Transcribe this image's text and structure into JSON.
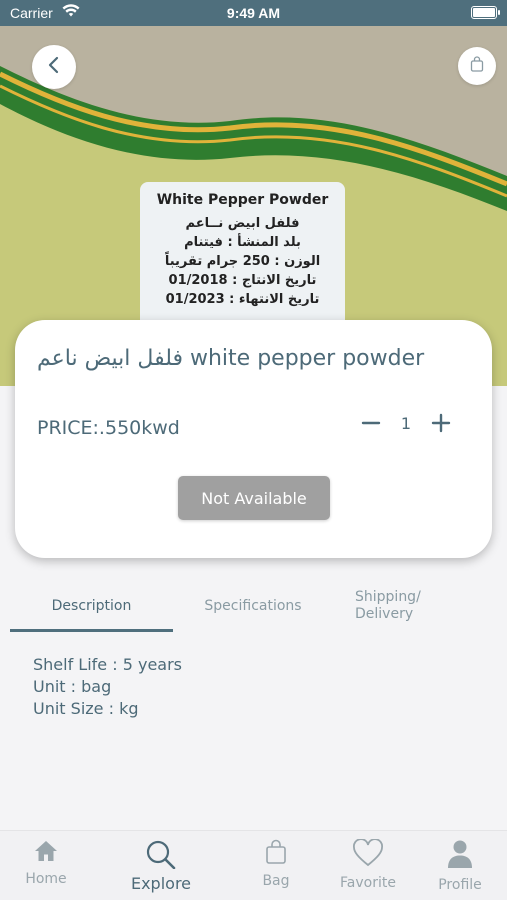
{
  "status_bar": {
    "carrier": "Carrier",
    "time": "9:49 AM"
  },
  "product_image": {
    "label_title": "White Pepper Powder",
    "label_lines": [
      "فلفل ابيض نــاعم",
      "بلد المنشأ : فيتنام",
      "الوزن : 250 جرام تقريباً",
      "تاريخ الانتاج : 01/2018",
      "تاريخ الانتهاء : 01/2023"
    ]
  },
  "product": {
    "title": "فلفل ابيض ناعم white pepper powder",
    "price": "PRICE:.550kwd",
    "quantity": "1",
    "availability_button": "Not Available"
  },
  "tabs": [
    {
      "label": "Description"
    },
    {
      "label": "Specifications"
    },
    {
      "label": "Shipping/ Delivery"
    }
  ],
  "description": {
    "shelf_life": "Shelf Life : 5 years",
    "unit": "Unit : bag",
    "unit_size": "Unit Size : kg"
  },
  "bottom_nav": [
    {
      "label": "Home",
      "icon": "home-icon"
    },
    {
      "label": "Explore",
      "icon": "search-icon"
    },
    {
      "label": "Bag",
      "icon": "bag-icon"
    },
    {
      "label": "Favorite",
      "icon": "heart-icon"
    },
    {
      "label": "Profile",
      "icon": "profile-icon"
    }
  ],
  "colors": {
    "accent": "#4f6f7d",
    "disabled": "#a0a0a0"
  }
}
